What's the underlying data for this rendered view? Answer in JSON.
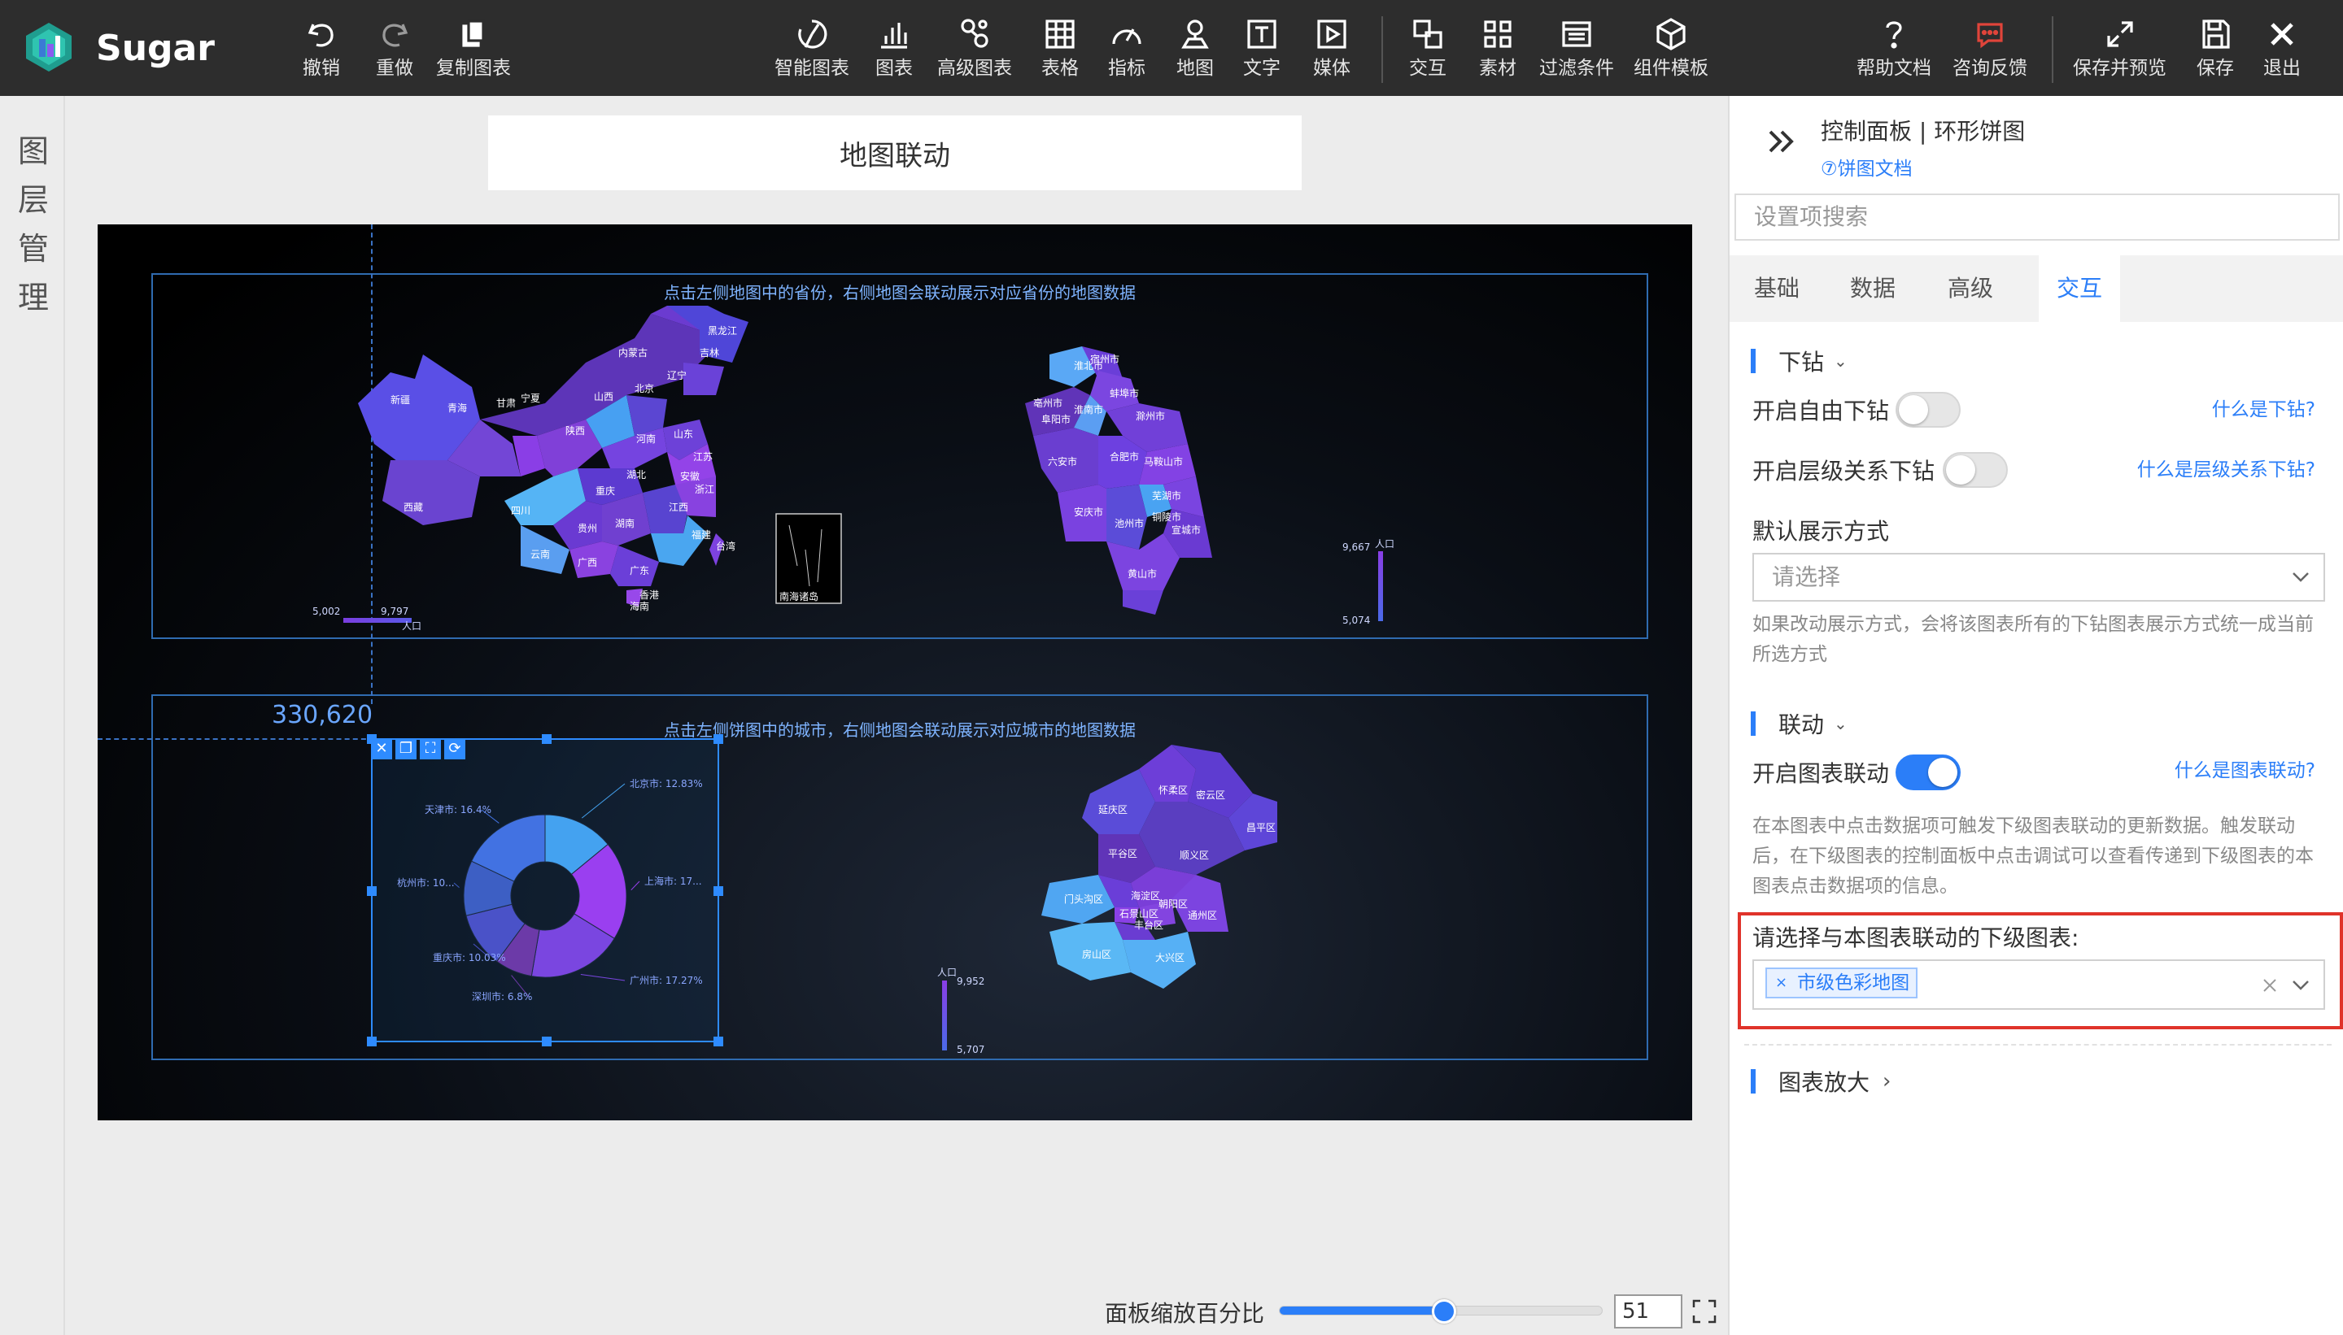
{
  "app": {
    "name": "Sugar"
  },
  "toolbar": {
    "undo": "撤销",
    "redo": "重做",
    "copy": "复制图表",
    "smart": "智能图表",
    "chart": "图表",
    "advanced": "高级图表",
    "table": "表格",
    "metric": "指标",
    "map": "地图",
    "text": "文字",
    "media": "媒体",
    "interact": "交互",
    "assets": "素材",
    "filter": "过滤条件",
    "template": "组件模板",
    "help": "帮助文档",
    "feedback": "咨询反馈",
    "save_preview": "保存并预览",
    "save": "保存",
    "exit": "退出"
  },
  "layer_panel": {
    "chars": [
      "图",
      "层",
      "管",
      "理"
    ]
  },
  "canvas": {
    "title": "地图联动",
    "frame1_caption": "点击左侧地图中的省份，右侧地图会联动展示对应省份的地图数据",
    "frame2_caption": "点击左侧饼图中的城市，右侧地图会联动展示对应城市的地图数据",
    "hover_value": "330,620",
    "china_legend": {
      "min": "5,002",
      "max": "9,797",
      "label": "人口"
    },
    "anhui_legend": {
      "max": "9,667",
      "min": "5,074",
      "label": "人口"
    },
    "beijing_legend": {
      "max": "9,952",
      "min": "5,707",
      "label": "人口"
    },
    "south_sea_label": "南海诸岛",
    "china_labels": [
      "黑龙江",
      "吉林",
      "内蒙古",
      "辽宁",
      "新疆",
      "青海",
      "甘肃",
      "宁夏",
      "北京",
      "山西",
      "陕西",
      "河南",
      "山东",
      "江苏",
      "安徽",
      "湖北",
      "四川",
      "西藏",
      "重庆",
      "湖南",
      "江西",
      "浙江",
      "贵州",
      "福建",
      "云南",
      "广西",
      "广东",
      "台湾",
      "香港",
      "海南"
    ],
    "anhui_labels": [
      "宿州市",
      "淮北市",
      "亳州市",
      "阜阳市",
      "蚌埠市",
      "淮南市",
      "滁州市",
      "六安市",
      "合肥市",
      "马鞍山市",
      "芜湖市",
      "铜陵市",
      "宣城市",
      "安庆市",
      "池州市",
      "黄山市"
    ],
    "beijing_labels": [
      "延庆区",
      "怀柔区",
      "密云区",
      "昌平区",
      "平谷区",
      "顺义区",
      "门头沟区",
      "海淀区",
      "石景山区",
      "朝阳区",
      "丰台区",
      "通州区",
      "房山区",
      "大兴区"
    ],
    "zoom_label": "面板缩放百分比",
    "zoom_value": "51",
    "zoom_fraction": 0.51
  },
  "chart_data": {
    "type": "pie",
    "subtype": "donut",
    "categories": [
      "北京市",
      "上海市",
      "广州市",
      "深圳市",
      "重庆市",
      "杭州市",
      "天津市"
    ],
    "labels": [
      "北京市: 12.83%",
      "上海市: 17...",
      "广州市: 17.27%",
      "深圳市: 6.8%",
      "重庆市: 10.03%",
      "杭州市: 10...",
      "天津市: 16.4%"
    ],
    "values": [
      12.83,
      18.0,
      17.27,
      6.8,
      10.03,
      10.0,
      16.4
    ],
    "colors": [
      "#44a2f0",
      "#9a3ff0",
      "#7a46e0",
      "#6c3aa8",
      "#4a52c8",
      "#3d5fc4",
      "#4272e2"
    ]
  },
  "panel": {
    "title": "控制面板 | 环形饼图",
    "doc_link": "⑦饼图文档",
    "search_placeholder": "设置项搜索",
    "tabs": [
      "基础",
      "数据",
      "高级",
      "交互"
    ],
    "drill": {
      "title": "下钻",
      "free": "开启自由下钻",
      "free_help": "什么是下钻?",
      "hier": "开启层级关系下钻",
      "hier_help": "什么是层级关系下钻?",
      "mode_label": "默认展示方式",
      "mode_placeholder": "请选择",
      "mode_hint": "如果改动展示方式，会将该图表所有的下钻图表展示方式统一成当前所选方式"
    },
    "linkage": {
      "title": "联动",
      "enable": "开启图表联动",
      "enable_help": "什么是图表联动?",
      "hint": "在本图表中点击数据项可触发下级图表联动的更新数据。触发联动后，在下级图表的控制面板中点击调试可以查看传递到下级图表的本图表点击数据项的信息。",
      "target_label": "请选择与本图表联动的下级图表:",
      "target_tag": "市级色彩地图"
    },
    "zoom_section": "图表放大"
  }
}
